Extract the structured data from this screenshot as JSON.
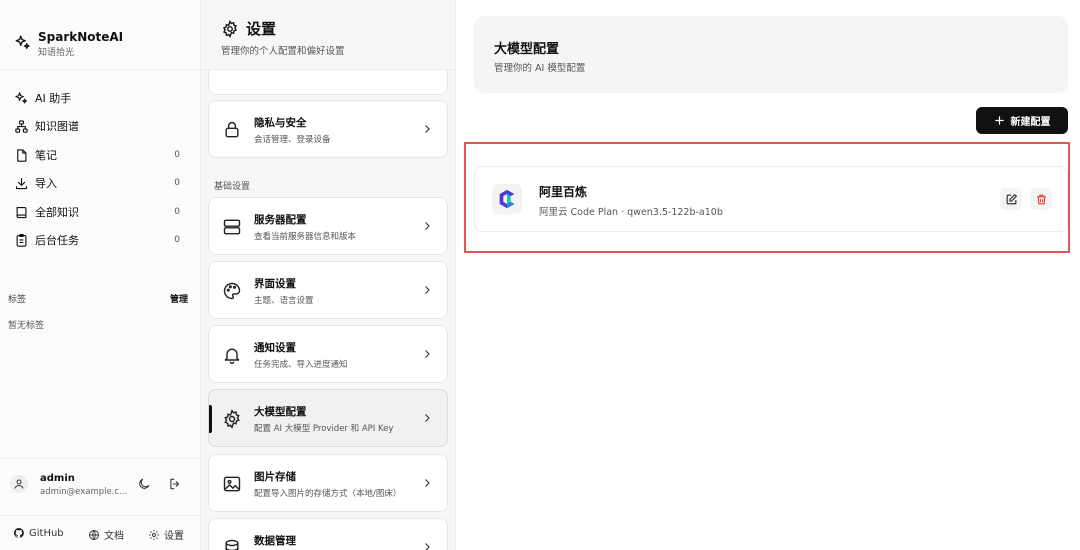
{
  "brand": {
    "title": "SparkNoteAI",
    "subtitle": "知语拾光"
  },
  "nav": [
    {
      "label": "AI 助手",
      "count": ""
    },
    {
      "label": "知识图谱",
      "count": ""
    },
    {
      "label": "笔记",
      "count": "0"
    },
    {
      "label": "导入",
      "count": "0"
    },
    {
      "label": "全部知识",
      "count": "0"
    },
    {
      "label": "后台任务",
      "count": "0"
    }
  ],
  "tags": {
    "title": "标签",
    "manage": "管理",
    "empty": "暂无标签"
  },
  "user": {
    "name": "admin",
    "email": "admin@example.c..."
  },
  "footer": {
    "github": "GitHub",
    "docs": "文档",
    "settings": "设置"
  },
  "settings": {
    "title": "设置",
    "subtitle": "管理你的个人配置和偏好设置",
    "section_basic": "基础设置",
    "cards": [
      {
        "title": "隐私与安全",
        "desc": "会话管理、登录设备"
      },
      {
        "title": "服务器配置",
        "desc": "查看当前服务器信息和版本"
      },
      {
        "title": "界面设置",
        "desc": "主题、语言设置"
      },
      {
        "title": "通知设置",
        "desc": "任务完成、导入进度通知"
      },
      {
        "title": "大模型配置",
        "desc": "配置 AI 大模型 Provider 和 API Key"
      },
      {
        "title": "图片存储",
        "desc": "配置导入图片的存储方式（本地/图床）"
      },
      {
        "title": "数据管理",
        "desc": ""
      }
    ]
  },
  "main": {
    "title": "大模型配置",
    "subtitle": "管理你的 AI 模型配置",
    "new_button": "新建配置",
    "providers": [
      {
        "name": "阿里百炼",
        "desc": "阿里云 Code Plan · qwen3.5-122b-a10b"
      }
    ]
  },
  "colors": {
    "accent": "#111111",
    "highlight": "#e25555",
    "delete": "#e53935"
  }
}
